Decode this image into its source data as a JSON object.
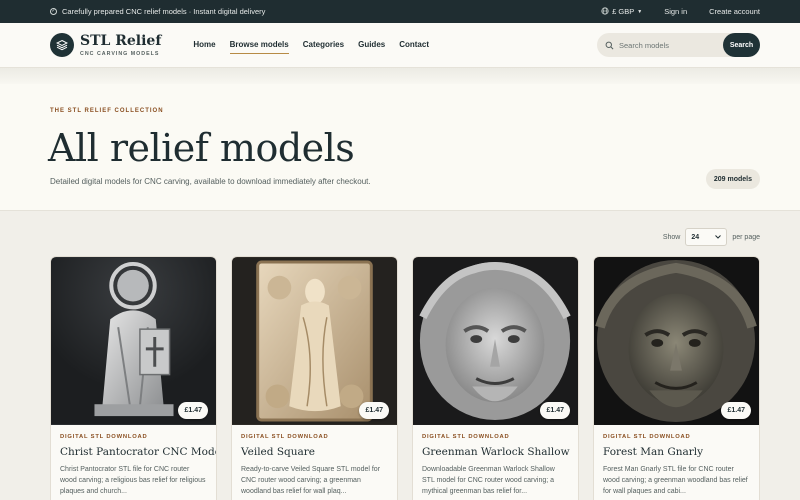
{
  "topbar": {
    "promo": "Carefully prepared CNC relief models · Instant digital delivery",
    "currency": "£ GBP",
    "sign_in": "Sign in",
    "create_account": "Create account"
  },
  "brand": {
    "name": "STL Relief",
    "tagline": "CNC CARVING MODELS"
  },
  "nav": {
    "items": [
      "Home",
      "Browse models",
      "Categories",
      "Guides",
      "Contact"
    ],
    "active": "Browse models"
  },
  "search": {
    "placeholder": "Search models",
    "button": "Search"
  },
  "hero": {
    "eyebrow": "THE STL RELIEF COLLECTION",
    "title": "All relief models",
    "lede": "Detailed digital models for CNC carving, available to download immediately after checkout.",
    "count": "209 models"
  },
  "perpage": {
    "label_before": "Show",
    "value": "24",
    "label_after": "per page"
  },
  "products": [
    {
      "kind": "DIGITAL STL DOWNLOAD",
      "title": "Christ Pantocrator CNC Model",
      "desc": "Christ Pantocrator STL file for CNC router wood carving; a religious bas relief for religious plaques and church...",
      "price": "£1.47",
      "image": "christ-pantocrator-relief"
    },
    {
      "kind": "DIGITAL STL DOWNLOAD",
      "title": "Veiled Square",
      "desc": "Ready-to-carve Veiled Square STL model for CNC router wood carving; a greenman woodland bas relief for wall plaq...",
      "price": "£1.47",
      "image": "veiled-figure-relief"
    },
    {
      "kind": "DIGITAL STL DOWNLOAD",
      "title": "Greenman Warlock Shallow",
      "desc": "Downloadable Greenman Warlock Shallow STL model for CNC router wood carving; a mythical greenman bas relief for...",
      "price": "£1.47",
      "image": "greenman-warlock-relief"
    },
    {
      "kind": "DIGITAL STL DOWNLOAD",
      "title": "Forest Man Gnarly",
      "desc": "Forest Man Gnarly STL file for CNC router wood carving; a greenman woodland bas relief for wall plaques and cabi...",
      "price": "£1.47",
      "image": "forest-man-relief"
    }
  ],
  "colors": {
    "dark": "#1f2d31",
    "accent": "#b78b45",
    "eyebrow": "#8a4f21",
    "page": "#f1efe9"
  }
}
